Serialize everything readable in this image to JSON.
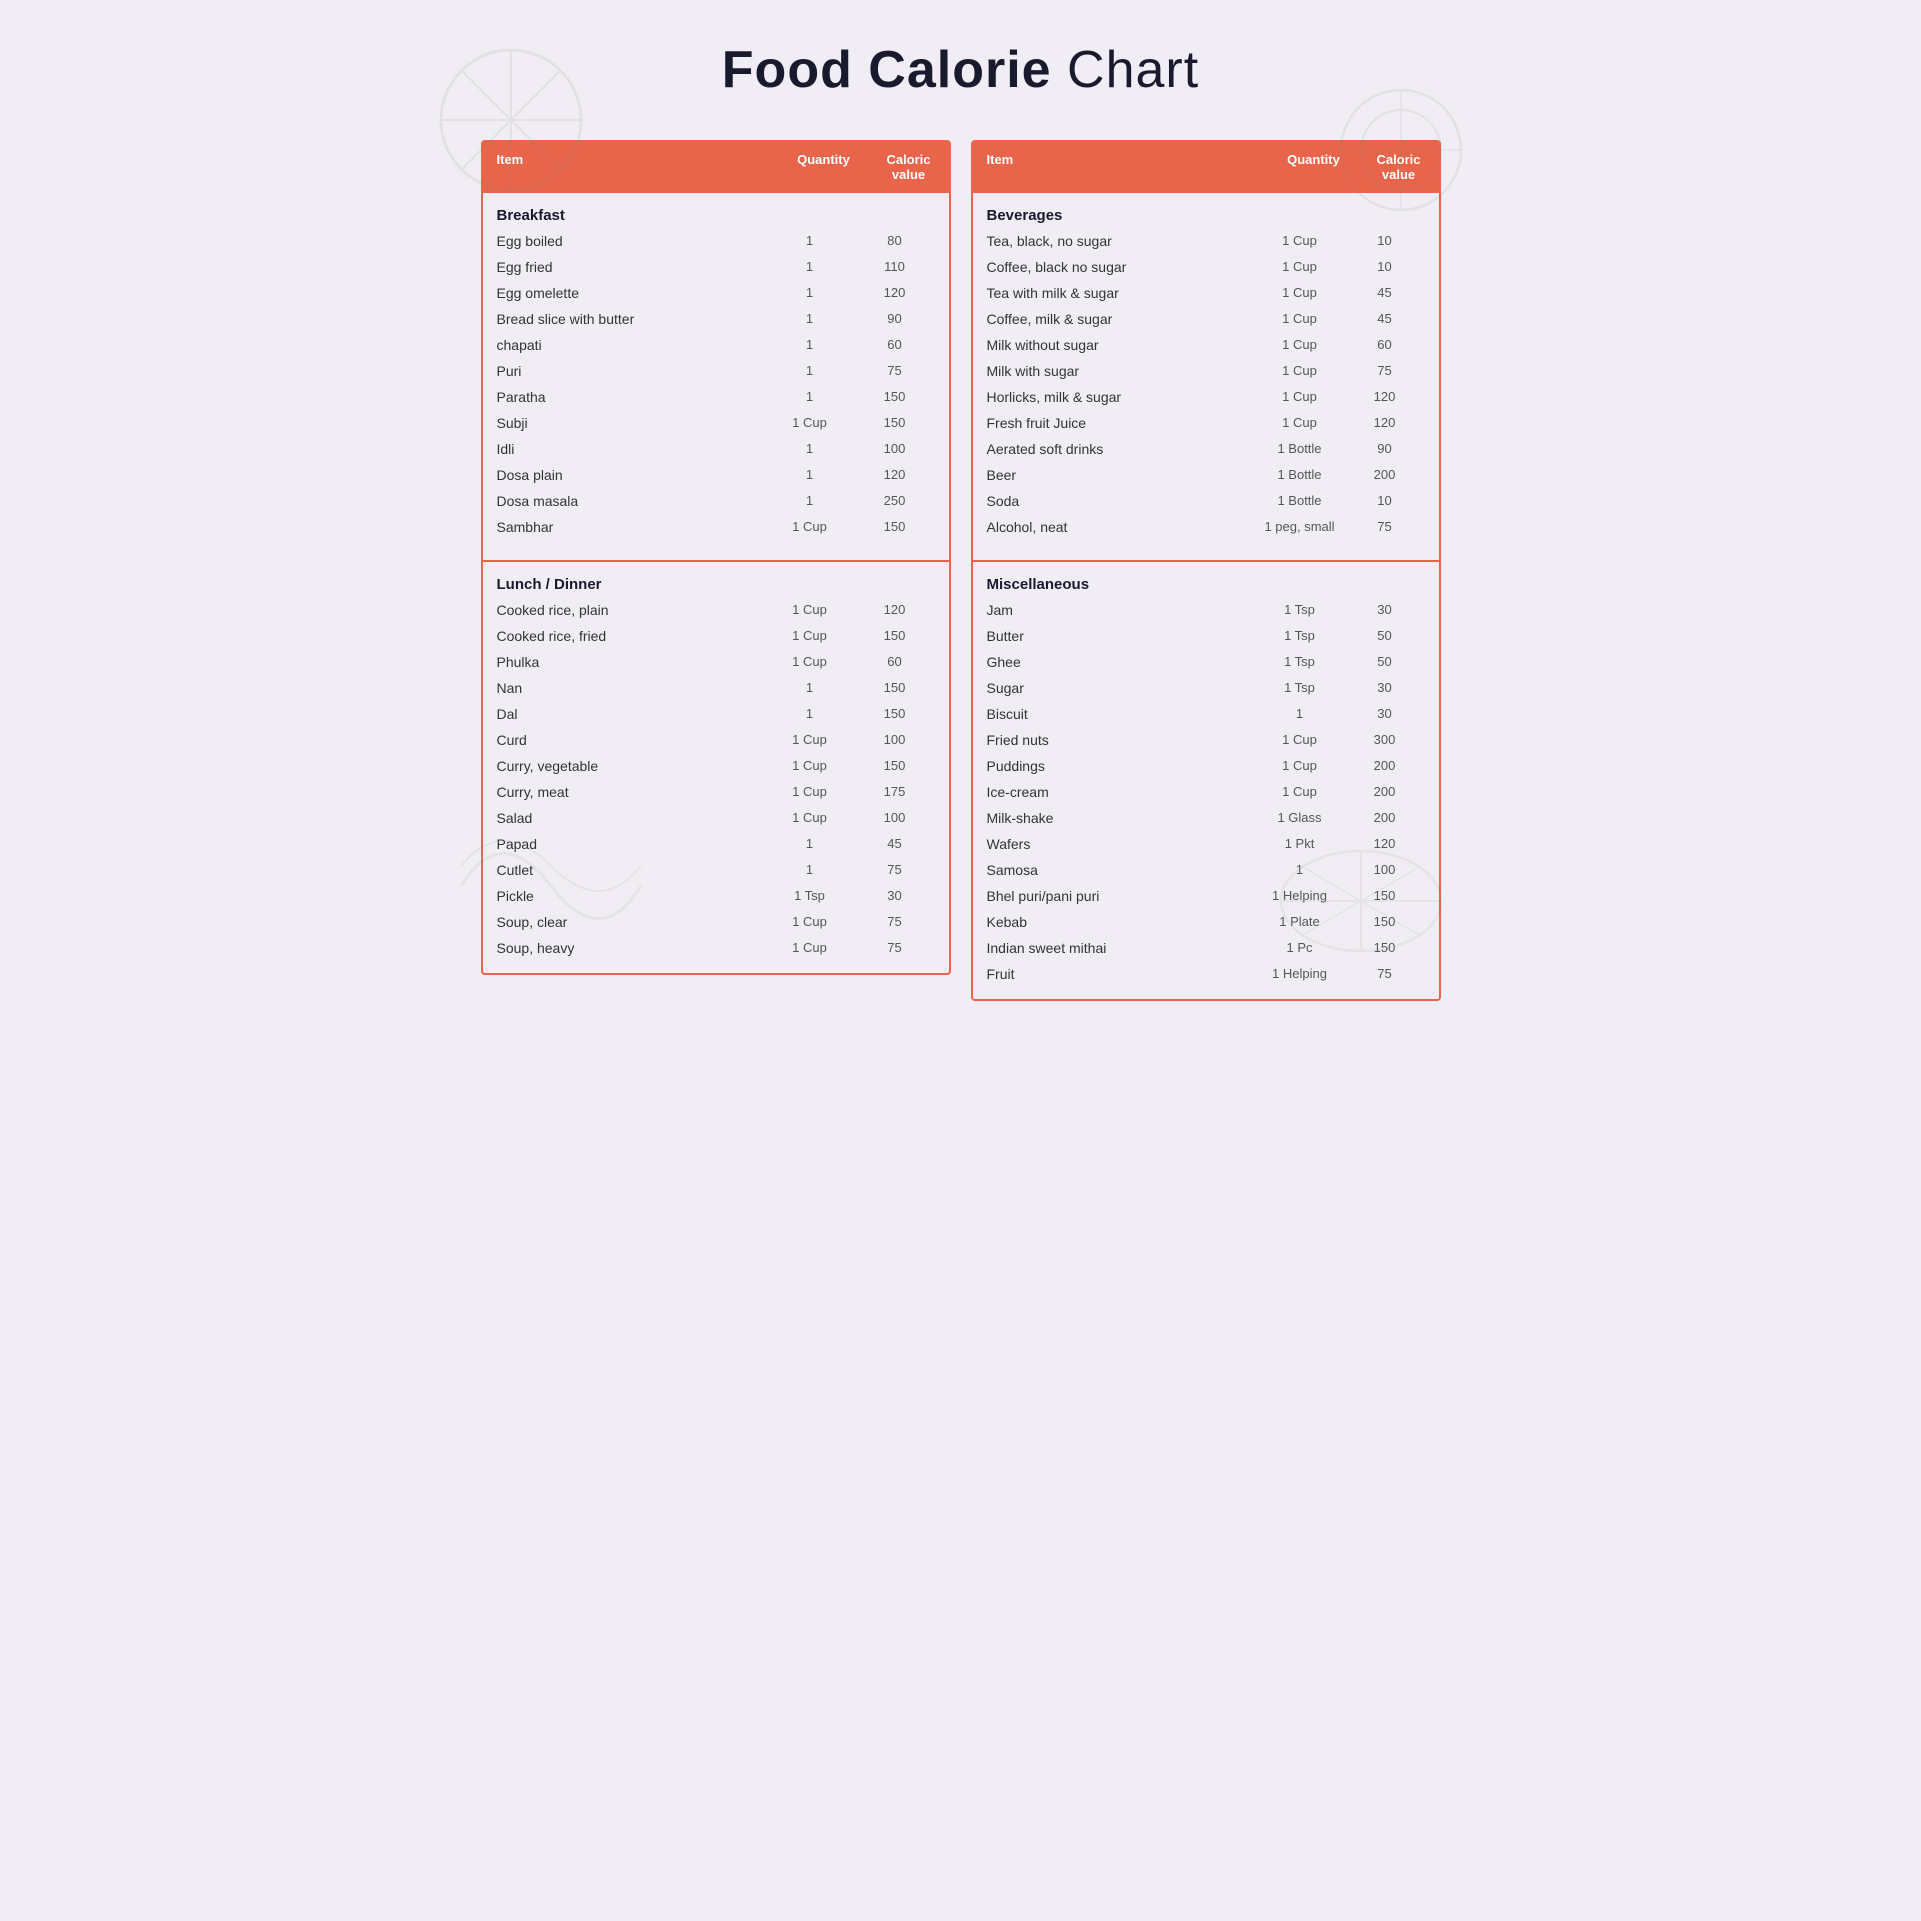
{
  "title": {
    "bold": "Food Calorie",
    "light": " Chart"
  },
  "left_table": {
    "headers": [
      "Item",
      "Quantity",
      "Caloric value"
    ],
    "sections": [
      {
        "category": "Breakfast",
        "items": [
          {
            "name": "Egg boiled",
            "qty": "1",
            "cal": "80"
          },
          {
            "name": "Egg fried",
            "qty": "1",
            "cal": "110"
          },
          {
            "name": "Egg omelette",
            "qty": "1",
            "cal": "120"
          },
          {
            "name": "Bread slice with butter",
            "qty": "1",
            "cal": "90"
          },
          {
            "name": "chapati",
            "qty": "1",
            "cal": "60"
          },
          {
            "name": "Puri",
            "qty": "1",
            "cal": "75"
          },
          {
            "name": "Paratha",
            "qty": "1",
            "cal": "150"
          },
          {
            "name": "Subji",
            "qty": "1 Cup",
            "cal": "150"
          },
          {
            "name": "Idli",
            "qty": "1",
            "cal": "100"
          },
          {
            "name": "Dosa plain",
            "qty": "1",
            "cal": "120"
          },
          {
            "name": "Dosa masala",
            "qty": "1",
            "cal": "250"
          },
          {
            "name": "Sambhar",
            "qty": "1 Cup",
            "cal": "150"
          }
        ]
      },
      {
        "category": "Lunch / Dinner",
        "items": [
          {
            "name": "Cooked rice, plain",
            "qty": "1 Cup",
            "cal": "120"
          },
          {
            "name": "Cooked rice, fried",
            "qty": "1 Cup",
            "cal": "150"
          },
          {
            "name": "Phulka",
            "qty": "1 Cup",
            "cal": "60"
          },
          {
            "name": "Nan",
            "qty": "1",
            "cal": "150"
          },
          {
            "name": "Dal",
            "qty": "1",
            "cal": "150"
          },
          {
            "name": "Curd",
            "qty": "1 Cup",
            "cal": "100"
          },
          {
            "name": "Curry, vegetable",
            "qty": "1 Cup",
            "cal": "150"
          },
          {
            "name": "Curry, meat",
            "qty": "1 Cup",
            "cal": "175"
          },
          {
            "name": "Salad",
            "qty": "1 Cup",
            "cal": "100"
          },
          {
            "name": "Papad",
            "qty": "1",
            "cal": "45"
          },
          {
            "name": "Cutlet",
            "qty": "1",
            "cal": "75"
          },
          {
            "name": "Pickle",
            "qty": "1 Tsp",
            "cal": "30"
          },
          {
            "name": "Soup, clear",
            "qty": "1 Cup",
            "cal": "75"
          },
          {
            "name": "Soup, heavy",
            "qty": "1 Cup",
            "cal": "75"
          }
        ]
      }
    ]
  },
  "right_table": {
    "headers": [
      "Item",
      "Quantity",
      "Caloric value"
    ],
    "sections": [
      {
        "category": "Beverages",
        "items": [
          {
            "name": "Tea, black, no sugar",
            "qty": "1 Cup",
            "cal": "10"
          },
          {
            "name": "Coffee, black no sugar",
            "qty": "1 Cup",
            "cal": "10"
          },
          {
            "name": "Tea with milk & sugar",
            "qty": "1 Cup",
            "cal": "45"
          },
          {
            "name": "Coffee, milk & sugar",
            "qty": "1 Cup",
            "cal": "45"
          },
          {
            "name": "Milk without sugar",
            "qty": "1 Cup",
            "cal": "60"
          },
          {
            "name": "Milk with sugar",
            "qty": "1 Cup",
            "cal": "75"
          },
          {
            "name": "Horlicks, milk & sugar",
            "qty": "1 Cup",
            "cal": "120"
          },
          {
            "name": "Fresh fruit Juice",
            "qty": "1 Cup",
            "cal": "120"
          },
          {
            "name": "Aerated soft drinks",
            "qty": "1 Bottle",
            "cal": "90"
          },
          {
            "name": "Beer",
            "qty": "1 Bottle",
            "cal": "200"
          },
          {
            "name": "Soda",
            "qty": "1 Bottle",
            "cal": "10"
          },
          {
            "name": "Alcohol, neat",
            "qty": "1 peg, small",
            "cal": "75"
          }
        ]
      },
      {
        "category": "Miscellaneous",
        "items": [
          {
            "name": "Jam",
            "qty": "1 Tsp",
            "cal": "30"
          },
          {
            "name": "Butter",
            "qty": "1 Tsp",
            "cal": "50"
          },
          {
            "name": "Ghee",
            "qty": "1 Tsp",
            "cal": "50"
          },
          {
            "name": "Sugar",
            "qty": "1 Tsp",
            "cal": "30"
          },
          {
            "name": "Biscuit",
            "qty": "1",
            "cal": "30"
          },
          {
            "name": "Fried nuts",
            "qty": "1 Cup",
            "cal": "300"
          },
          {
            "name": "Puddings",
            "qty": "1 Cup",
            "cal": "200"
          },
          {
            "name": "Ice-cream",
            "qty": "1 Cup",
            "cal": "200"
          },
          {
            "name": "Milk-shake",
            "qty": "1 Glass",
            "cal": "200"
          },
          {
            "name": "Wafers",
            "qty": "1 Pkt",
            "cal": "120"
          },
          {
            "name": "Samosa",
            "qty": "1",
            "cal": "100"
          },
          {
            "name": "Bhel puri/pani puri",
            "qty": "1 Helping",
            "cal": "150"
          },
          {
            "name": "Kebab",
            "qty": "1 Plate",
            "cal": "150"
          },
          {
            "name": "Indian sweet mithai",
            "qty": "1 Pc",
            "cal": "150"
          },
          {
            "name": "Fruit",
            "qty": "1 Helping",
            "cal": "75"
          }
        ]
      }
    ]
  }
}
